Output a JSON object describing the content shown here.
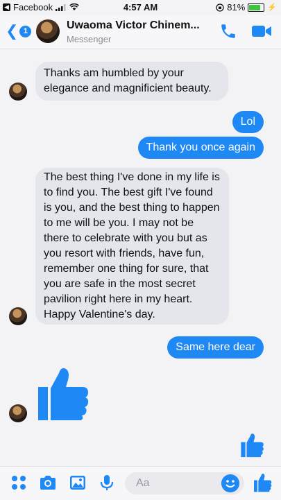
{
  "status_bar": {
    "back_app": "Facebook",
    "time": "4:57 AM",
    "battery": "81%",
    "battery_level": 0.81
  },
  "header": {
    "back_count": "1",
    "contact_name": "Uwaoma Victor Chinem...",
    "subtitle": "Messenger"
  },
  "messages": [
    {
      "direction": "incoming",
      "text": "Thanks am humbled by your elegance and magnificient beauty."
    },
    {
      "direction": "outgoing",
      "text": "Lol"
    },
    {
      "direction": "outgoing",
      "text": "Thank you once again"
    },
    {
      "direction": "incoming",
      "text": "The best thing I've done in my life is to find you. The best gift I've found is you, and the best thing to happen to me will be you. I may not be there to celebrate with you but as you resort with friends, have fun,  remember one thing for sure, that you are safe in the most secret pavilion right here in my heart. Happy Valentine's day."
    },
    {
      "direction": "outgoing",
      "text": "Same here dear"
    },
    {
      "direction": "incoming",
      "type": "like-sticker",
      "icon": "thumbs-up-icon"
    }
  ],
  "composer": {
    "placeholder": "Aa",
    "icons": [
      "apps-icon",
      "camera-icon",
      "gallery-icon",
      "microphone-icon",
      "emoji-icon",
      "thumbs-up-icon"
    ]
  },
  "colors": {
    "accent": "#1e88f5",
    "incoming_bubble": "#e4e6eb",
    "background": "#f3f3f6"
  }
}
